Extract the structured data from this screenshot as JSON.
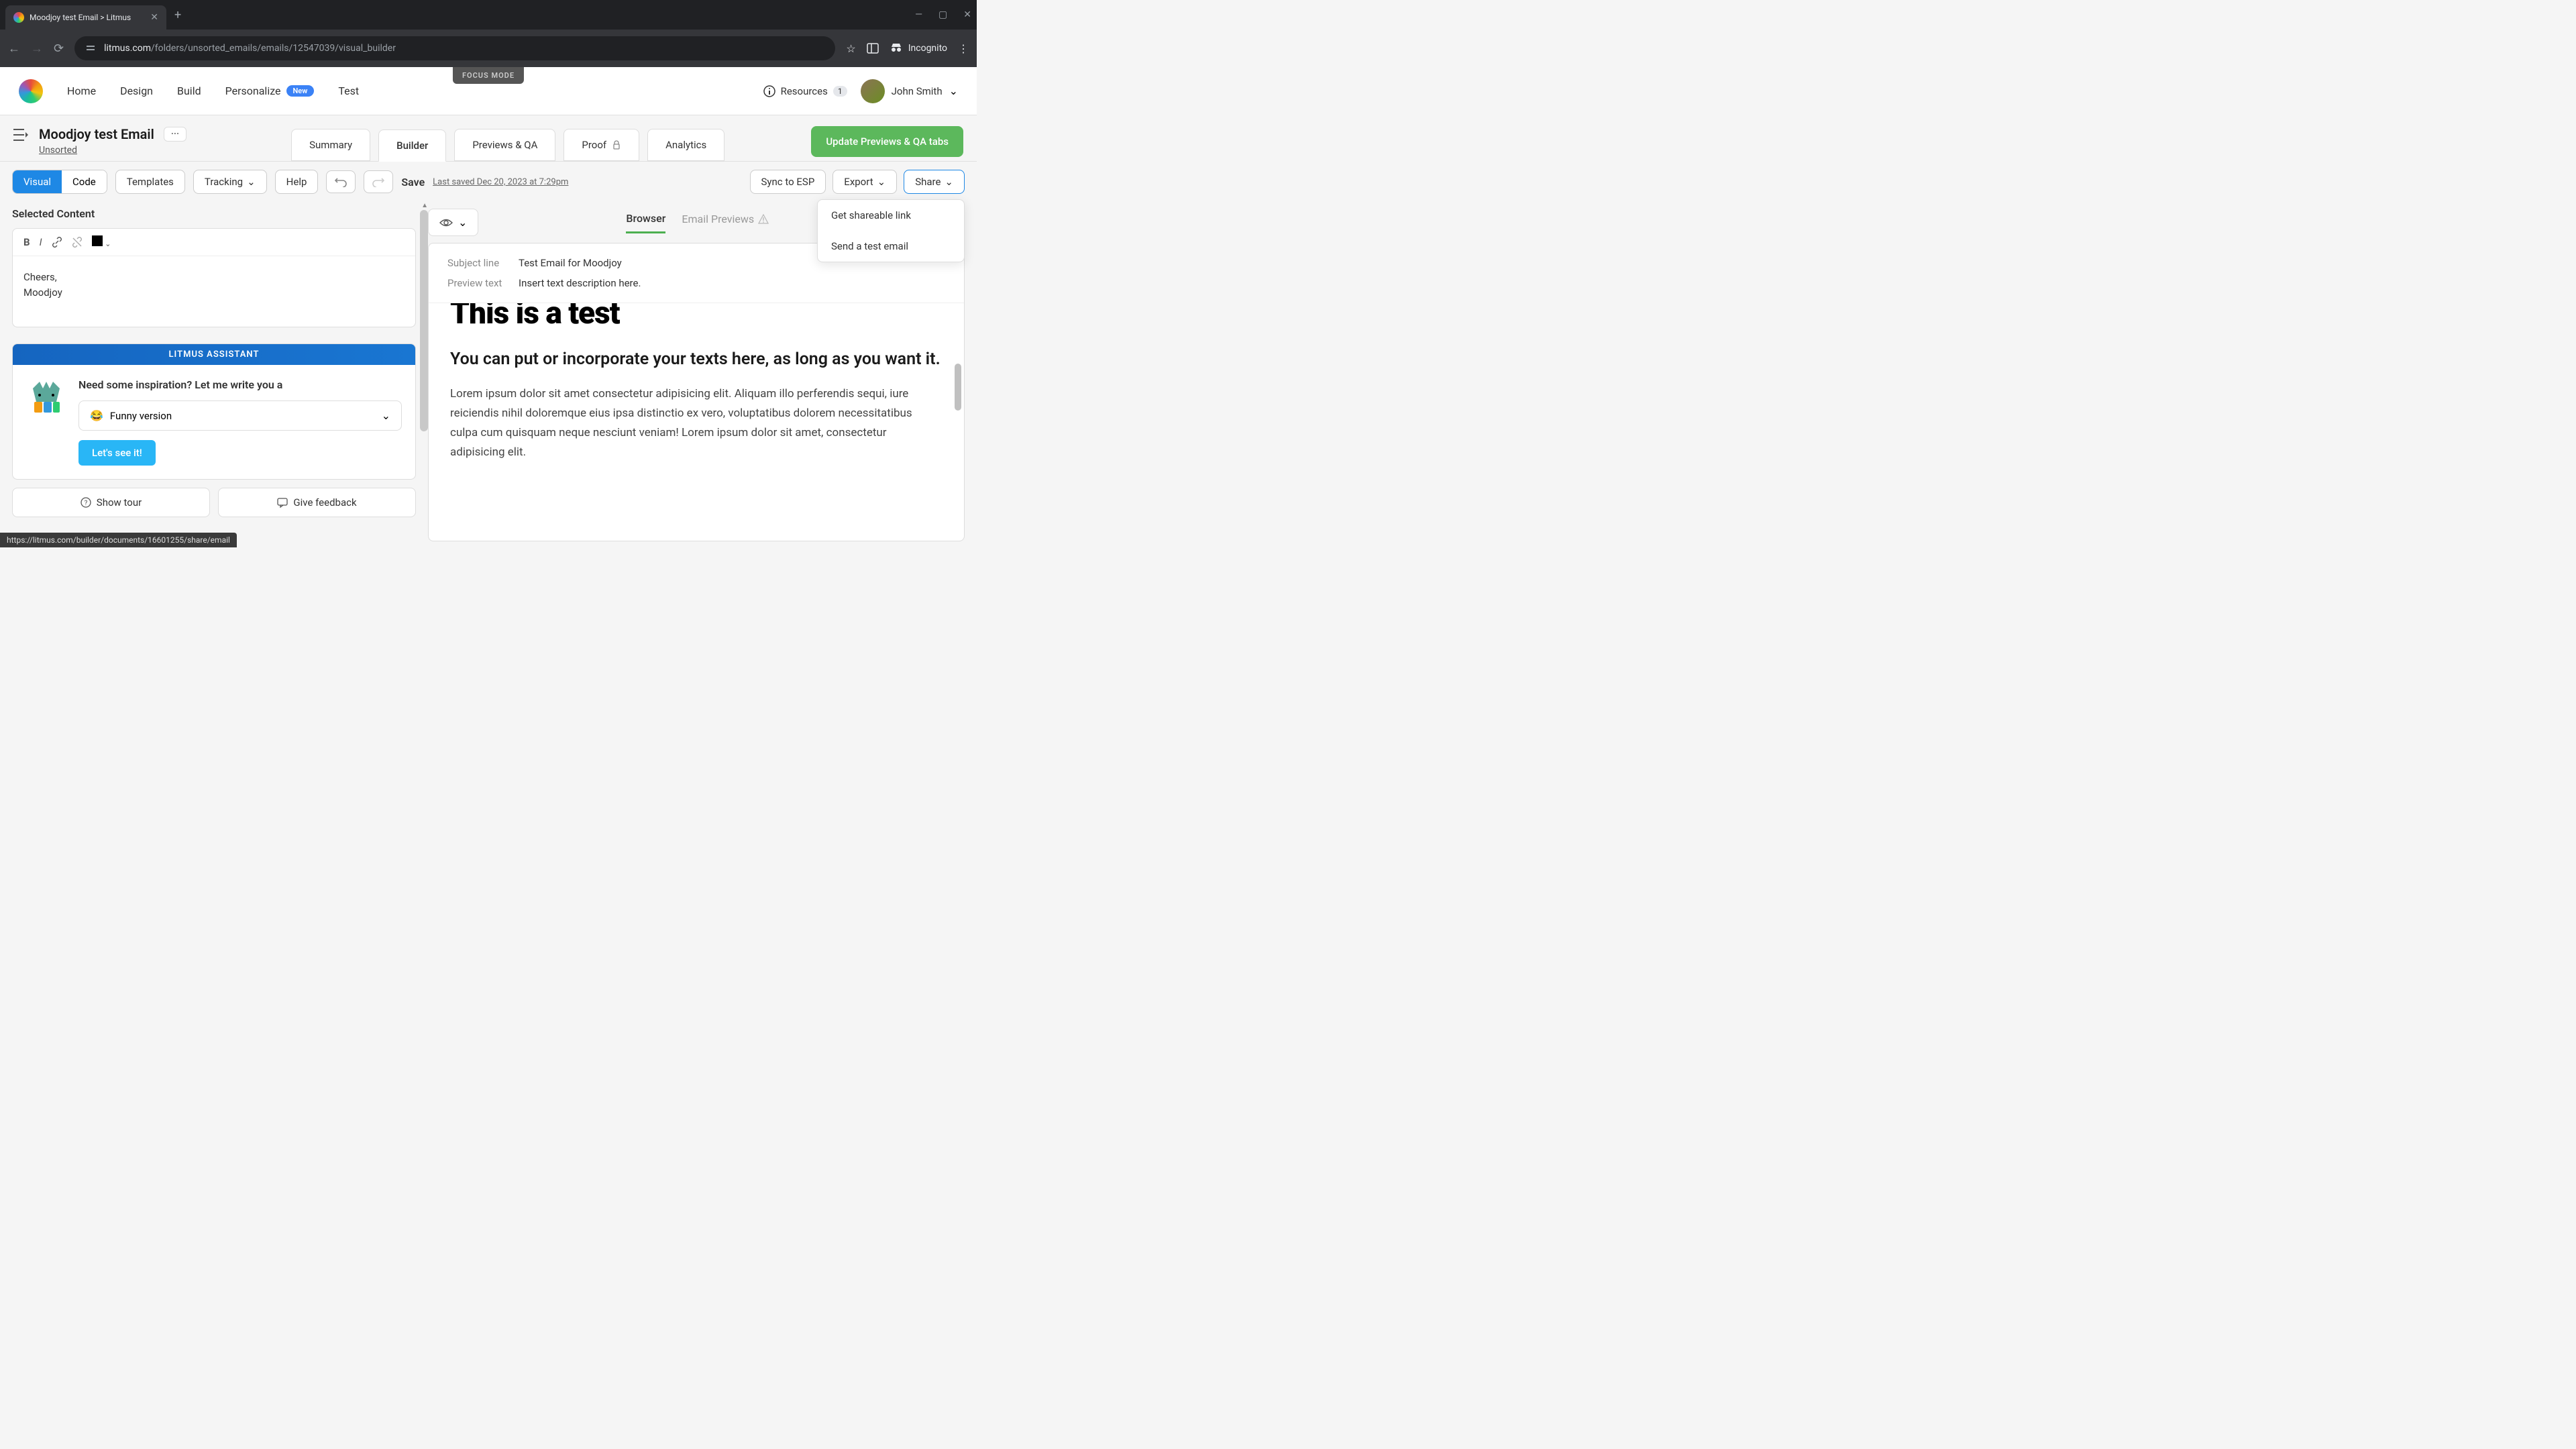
{
  "browser": {
    "tab_title": "Moodjoy test Email > Litmus",
    "url_prefix": "litmus.com",
    "url_path": "/folders/unsorted_emails/emails/12547039/visual_builder",
    "incognito": "Incognito"
  },
  "nav": {
    "items": [
      "Home",
      "Design",
      "Build",
      "Personalize",
      "Test"
    ],
    "new_badge": "New",
    "focus_mode": "FOCUS MODE",
    "resources": "Resources",
    "resources_count": "1",
    "user_name": "John Smith"
  },
  "doc": {
    "title": "Moodjoy test Email",
    "more": "···",
    "folder": "Unsorted",
    "tabs": [
      "Summary",
      "Builder",
      "Previews & QA",
      "Proof",
      "Analytics"
    ],
    "update_btn": "Update Previews & QA tabs"
  },
  "toolbar": {
    "visual": "Visual",
    "code": "Code",
    "templates": "Templates",
    "tracking": "Tracking",
    "help": "Help",
    "save": "Save",
    "saved_info": "Last saved Dec 20, 2023 at 7:29pm",
    "sync": "Sync to ESP",
    "export": "Export",
    "share": "Share",
    "share_menu": {
      "link": "Get shareable link",
      "test": "Send a test email"
    }
  },
  "editor": {
    "section_title": "Selected Content",
    "content_line1": "Cheers,",
    "content_line2": "Moodjoy"
  },
  "assistant": {
    "header": "LITMUS ASSISTANT",
    "title": "Need some inspiration? Let me write you a",
    "select_emoji": "😂",
    "select_text": "Funny version",
    "cta": "Let's see it!"
  },
  "actions": {
    "tour": "Show tour",
    "feedback": "Give feedback"
  },
  "preview": {
    "browser_tab": "Browser",
    "email_previews_tab": "Email Previews",
    "subject_label": "Subject line",
    "subject_value": "Test Email for Moodjoy",
    "preview_label": "Preview text",
    "preview_value": "Insert text description here.",
    "h1": "This is a test",
    "h2": "You can put or incorporate your texts here, as long as you want it.",
    "body": "Lorem ipsum dolor sit amet consectetur adipisicing elit. Aliquam illo perferendis sequi, iure reiciendis nihil doloremque eius ipsa distinctio ex vero, voluptatibus dolorem necessitatibus culpa cum quisquam neque nesciunt veniam! Lorem ipsum dolor sit amet, consectetur adipisicing elit."
  },
  "status_url": "https://litmus.com/builder/documents/16601255/share/email"
}
